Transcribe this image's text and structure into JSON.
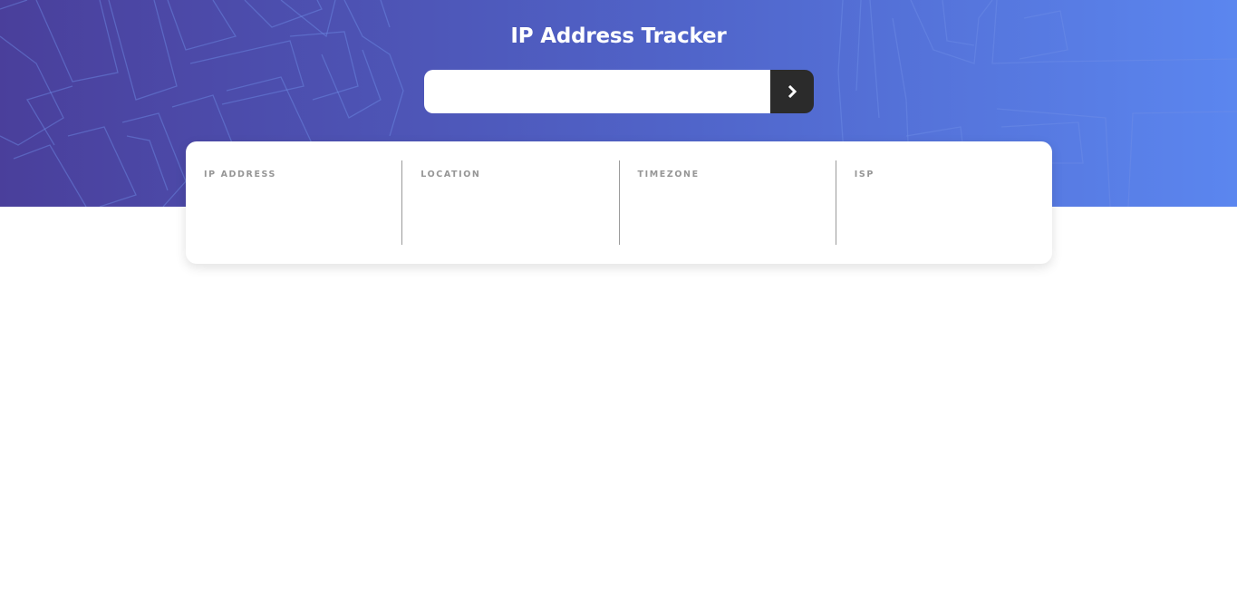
{
  "header": {
    "title": "IP Address Tracker"
  },
  "search": {
    "value": "",
    "placeholder": "",
    "submit_icon": "chevron-right-icon"
  },
  "info": {
    "columns": [
      {
        "label": "IP ADDRESS",
        "value": ""
      },
      {
        "label": "LOCATION",
        "value": ""
      },
      {
        "label": "TIMEZONE",
        "value": ""
      },
      {
        "label": "ISP",
        "value": ""
      }
    ]
  },
  "colors": {
    "hero_start": "#4a3f9b",
    "hero_end": "#5b86ef",
    "button_bg": "#2b2b2b",
    "label_gray": "#969696"
  }
}
